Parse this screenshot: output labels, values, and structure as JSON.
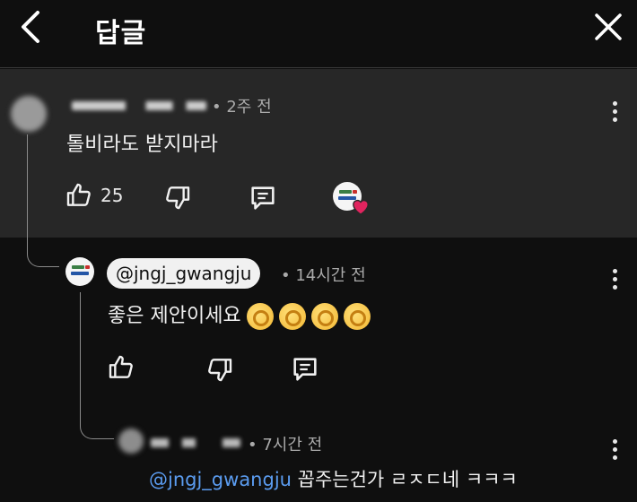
{
  "header": {
    "title": "답글"
  },
  "top_comment": {
    "time": "• 2주 전",
    "text": "톨비라도 받지마라",
    "like_count": "25"
  },
  "reply1": {
    "handle": "@jngj_gwangju",
    "time": "• 14시간 전",
    "text": "좋은 제안이세요",
    "emoji_count": 4
  },
  "reply2": {
    "time": "• 7시간 전",
    "mention": "@jngj_gwangju",
    "text": " 꼽주는건가 ㄹㅈㄷ네 ㅋㅋㅋ"
  },
  "icons": {
    "back": "chevron-left-icon",
    "close": "close-icon",
    "like": "thumbs-up-icon",
    "dislike": "thumbs-down-icon",
    "reply": "comment-icon",
    "more": "more-vertical-icon",
    "heart": "heart-icon"
  },
  "colors": {
    "background": "#0f0f0f",
    "highlight_bg": "#272727",
    "mention": "#5b9cf0",
    "heart": "#e0245e"
  }
}
